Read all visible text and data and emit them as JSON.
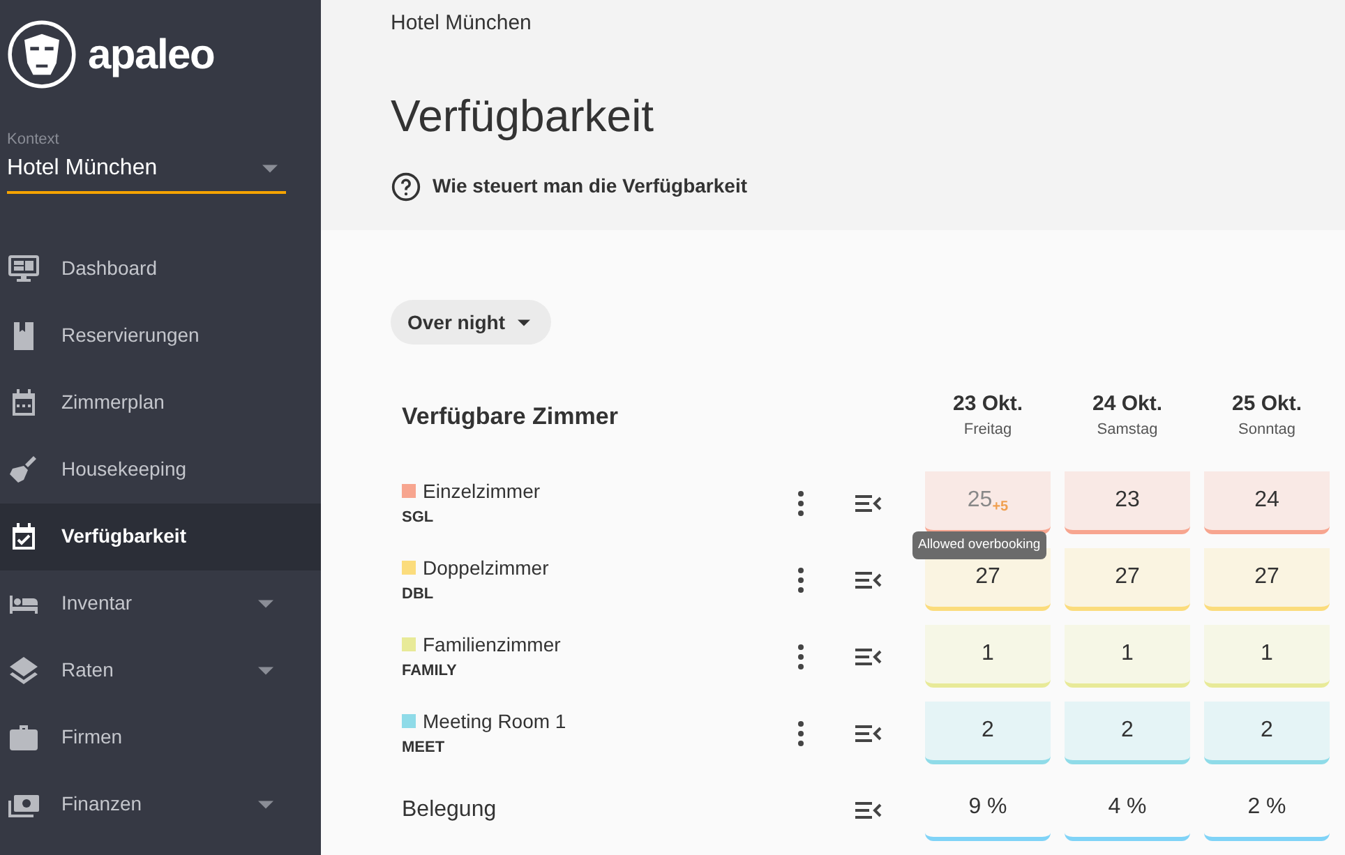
{
  "sidebar": {
    "brand": "apaleo",
    "context": {
      "label": "Kontext",
      "value": "Hotel München"
    },
    "items": [
      {
        "label": "Dashboard",
        "selected": false,
        "expandable": false
      },
      {
        "label": "Reservierungen",
        "selected": false,
        "expandable": false
      },
      {
        "label": "Zimmerplan",
        "selected": false,
        "expandable": false
      },
      {
        "label": "Housekeeping",
        "selected": false,
        "expandable": false
      },
      {
        "label": "Verfügbarkeit",
        "selected": true,
        "expandable": false
      },
      {
        "label": "Inventar",
        "selected": false,
        "expandable": true
      },
      {
        "label": "Raten",
        "selected": false,
        "expandable": true
      },
      {
        "label": "Firmen",
        "selected": false,
        "expandable": false
      },
      {
        "label": "Finanzen",
        "selected": false,
        "expandable": true
      }
    ]
  },
  "breadcrumb": "Hotel München",
  "title": "Verfügbarkeit",
  "help_link": "Wie steuert man die Verfügbarkeit",
  "filter": {
    "value": "Over night"
  },
  "table": {
    "heading": "Verfügbare Zimmer",
    "days": [
      {
        "date": "23 Okt.",
        "weekday": "Freitag"
      },
      {
        "date": "24 Okt.",
        "weekday": "Samstag"
      },
      {
        "date": "25 Okt.",
        "weekday": "Sonntag"
      }
    ],
    "rows": [
      {
        "name": "Einzelzimmer",
        "code": "SGL",
        "color": "#f7a58f",
        "cells": [
          {
            "value": "25",
            "extra": "+5",
            "dimmed": true
          },
          {
            "value": "23",
            "dimmed": false
          },
          {
            "value": "24",
            "dimmed": false
          }
        ]
      },
      {
        "name": "Doppelzimmer",
        "code": "DBL",
        "color": "#fbdc7c",
        "cells": [
          {
            "value": "27",
            "dimmed": false
          },
          {
            "value": "27",
            "dimmed": false
          },
          {
            "value": "27",
            "dimmed": false
          }
        ]
      },
      {
        "name": "Familienzimmer",
        "code": "FAMILY",
        "color": "#e8ea98",
        "cells": [
          {
            "value": "1",
            "dimmed": false
          },
          {
            "value": "1",
            "dimmed": false
          },
          {
            "value": "1",
            "dimmed": false
          }
        ]
      },
      {
        "name": "Meeting Room 1",
        "code": "MEET",
        "color": "#8fdbe8",
        "cells": [
          {
            "value": "2",
            "dimmed": false
          },
          {
            "value": "2",
            "dimmed": false
          },
          {
            "value": "2",
            "dimmed": false
          }
        ]
      }
    ],
    "occupancy": {
      "label": "Belegung",
      "cells": [
        {
          "value": "9 %"
        },
        {
          "value": "4 %"
        },
        {
          "value": "2 %"
        }
      ]
    }
  },
  "tooltip": "Allowed overbooking"
}
